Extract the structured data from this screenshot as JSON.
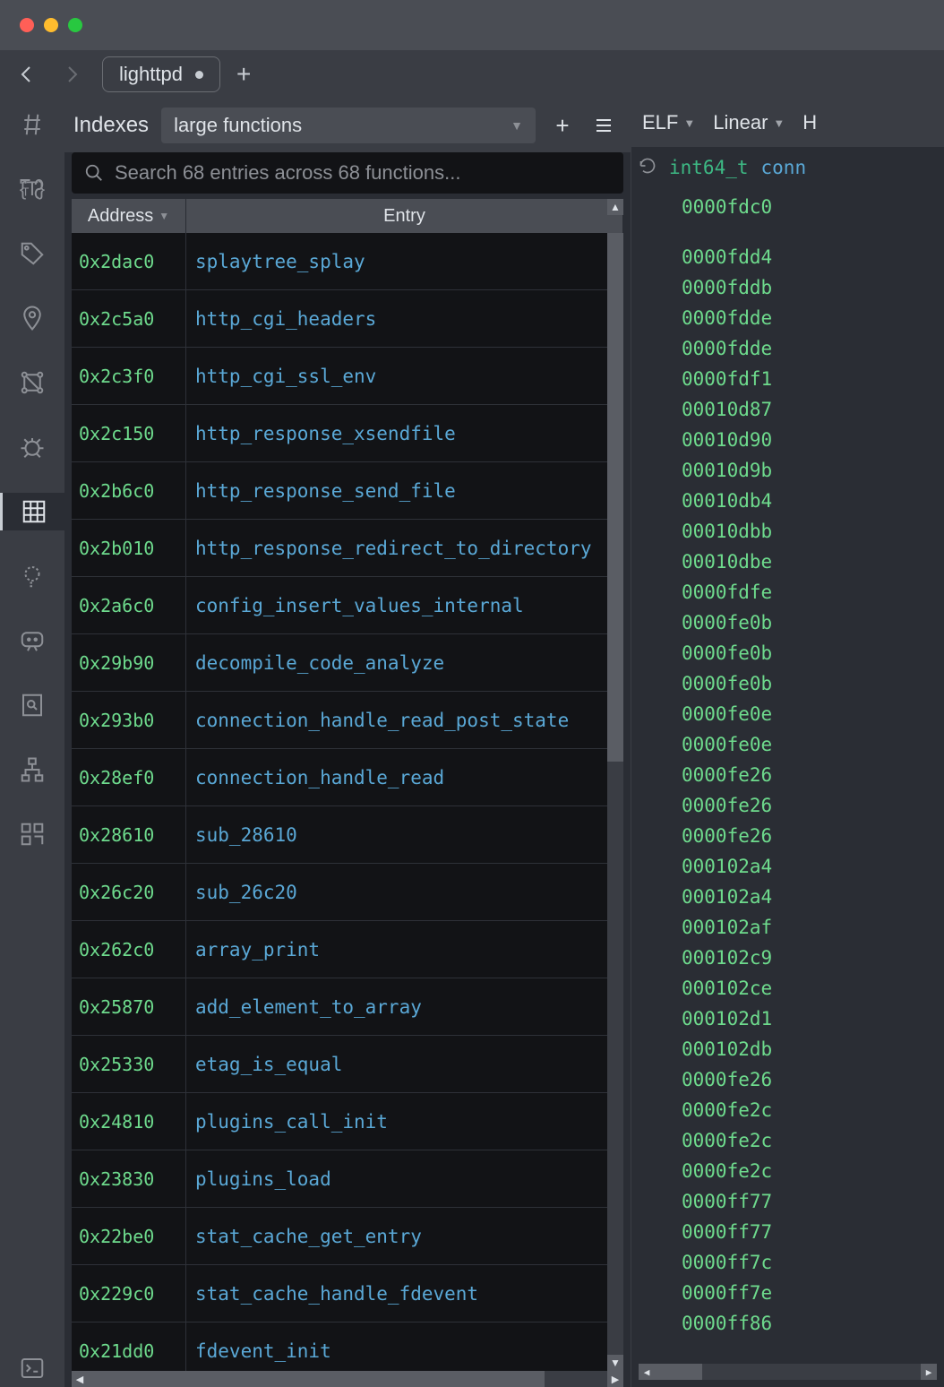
{
  "tab": {
    "name": "lighttpd"
  },
  "indexes": {
    "title": "Indexes",
    "dropdown_value": "large functions",
    "search_placeholder": "Search 68 entries across 68 functions...",
    "columns": {
      "address": "Address",
      "entry": "Entry"
    },
    "rows": [
      {
        "address": "0x2dac0",
        "entry": "splaytree_splay"
      },
      {
        "address": "0x2c5a0",
        "entry": "http_cgi_headers"
      },
      {
        "address": "0x2c3f0",
        "entry": "http_cgi_ssl_env"
      },
      {
        "address": "0x2c150",
        "entry": "http_response_xsendfile"
      },
      {
        "address": "0x2b6c0",
        "entry": "http_response_send_file"
      },
      {
        "address": "0x2b010",
        "entry": "http_response_redirect_to_directory"
      },
      {
        "address": "0x2a6c0",
        "entry": "config_insert_values_internal"
      },
      {
        "address": "0x29b90",
        "entry": "decompile_code_analyze"
      },
      {
        "address": "0x293b0",
        "entry": "connection_handle_read_post_state"
      },
      {
        "address": "0x28ef0",
        "entry": "connection_handle_read"
      },
      {
        "address": "0x28610",
        "entry": "sub_28610"
      },
      {
        "address": "0x26c20",
        "entry": "sub_26c20"
      },
      {
        "address": "0x262c0",
        "entry": "array_print"
      },
      {
        "address": "0x25870",
        "entry": "add_element_to_array"
      },
      {
        "address": "0x25330",
        "entry": "etag_is_equal"
      },
      {
        "address": "0x24810",
        "entry": "plugins_call_init"
      },
      {
        "address": "0x23830",
        "entry": "plugins_load"
      },
      {
        "address": "0x22be0",
        "entry": "stat_cache_get_entry"
      },
      {
        "address": "0x229c0",
        "entry": "stat_cache_handle_fdevent"
      },
      {
        "address": "0x21dd0",
        "entry": "fdevent_init"
      }
    ]
  },
  "disasm": {
    "toolbar": {
      "format": "ELF",
      "view": "Linear",
      "extra": "H"
    },
    "sig_type": "int64_t",
    "sig_name": "conn",
    "first_addr": "0000fdc0",
    "lines": [
      "0000fdd4",
      "0000fddb",
      "0000fdde",
      "0000fdde",
      "0000fdf1",
      "00010d87",
      "00010d90",
      "00010d9b",
      "00010db4",
      "00010dbb",
      "00010dbe",
      "0000fdfe",
      "0000fe0b",
      "0000fe0b",
      "0000fe0b",
      "0000fe0e",
      "0000fe0e",
      "0000fe26",
      "0000fe26",
      "0000fe26",
      "000102a4",
      "000102a4",
      "000102af",
      "000102c9",
      "000102ce",
      "000102d1",
      "000102db",
      "0000fe26",
      "0000fe2c",
      "0000fe2c",
      "0000fe2c",
      "0000ff77",
      "0000ff77",
      "0000ff7c",
      "0000ff7e",
      "0000ff86"
    ]
  },
  "colors": {
    "green": "#6edb8d",
    "blue": "#5aa8d6",
    "type_green": "#3db984"
  }
}
